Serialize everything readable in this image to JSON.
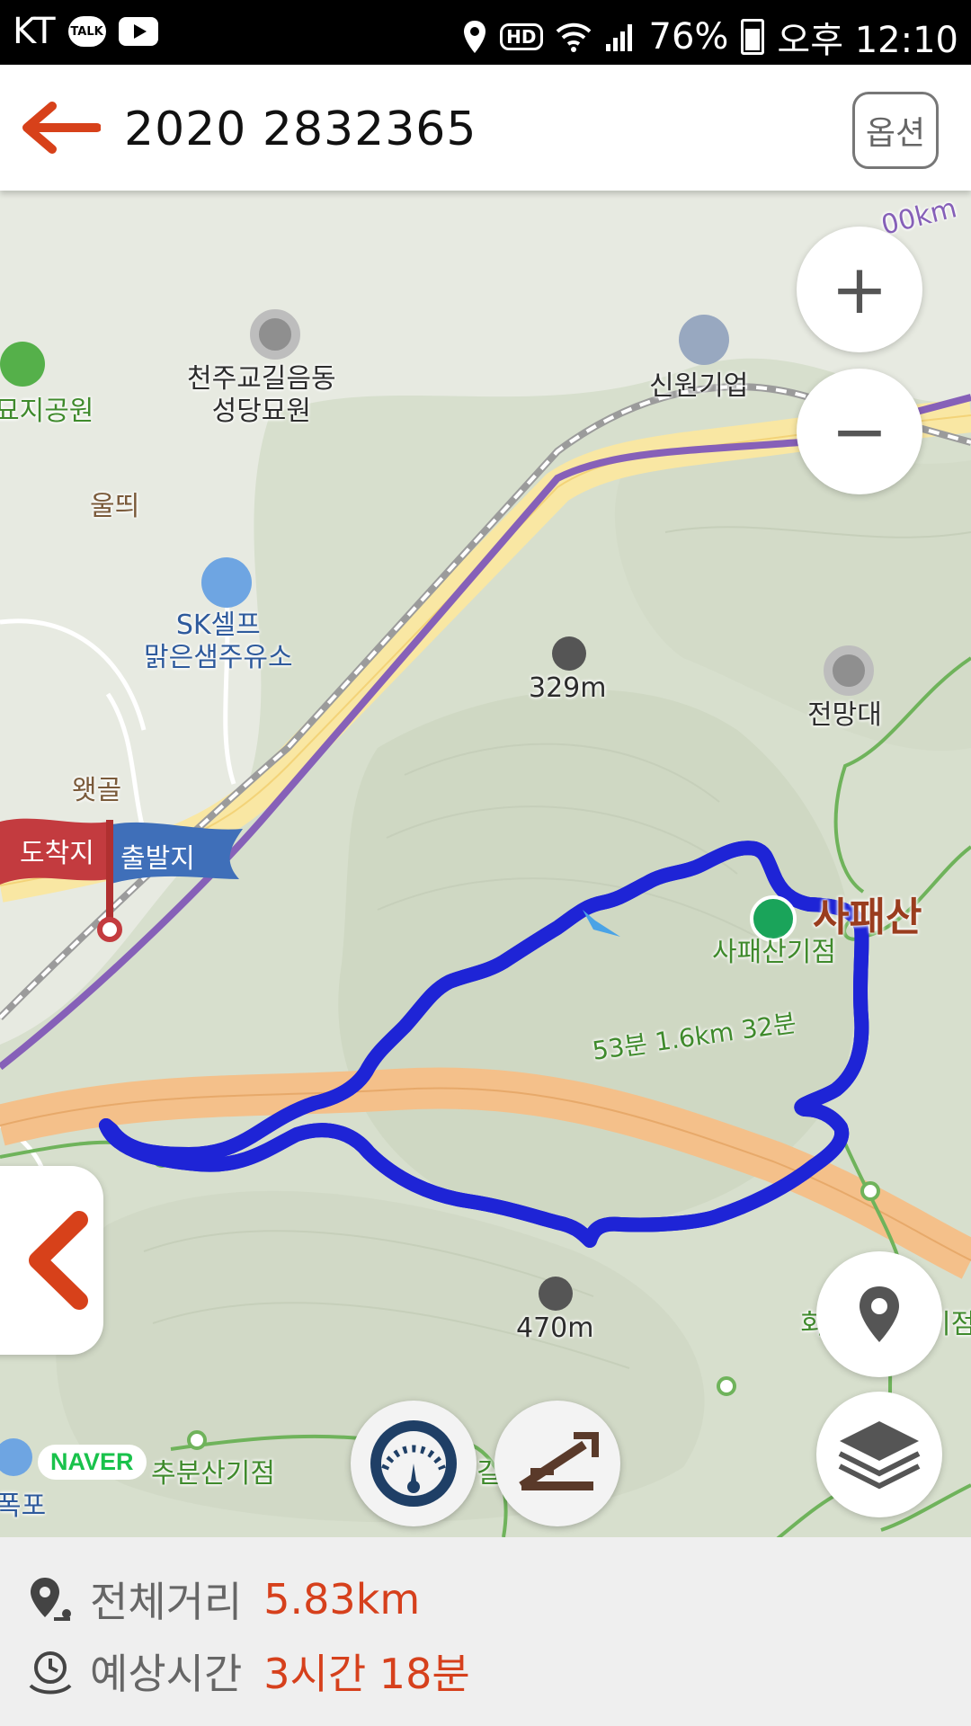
{
  "status_bar": {
    "carrier": "KT",
    "talk_icon_text": "TALK",
    "hd_label": "HD",
    "battery": "76%",
    "time": "오후 12:10"
  },
  "header": {
    "title": "2020 2832365",
    "option_label": "옵션"
  },
  "map": {
    "labels": {
      "cemetery_left": "묘지공원",
      "catholic_cemetery": "천주교길음동\n성당묘원",
      "village_ulttui": "울띄",
      "gas_station": "SK셀프\n맑은샘주유소",
      "company": "신원기업",
      "peak_329": "329m",
      "observatory": "전망대",
      "village_waetgol": "왯골",
      "mountain": "사패산",
      "mountain_point": "사패산기점",
      "route_time": "53분 1.6km 32분",
      "peak_470": "470m",
      "left_bottom": "폭포",
      "bottom_point": "추분산기점",
      "right_edge": "회",
      "right_edge2": "기점",
      "highway_label": "00km",
      "bottom_mid": "길"
    },
    "flags": {
      "arrival": "도착지",
      "departure": "출발지"
    },
    "naver_logo": "NAVER",
    "route_color": "#1e24d6"
  },
  "controls": {
    "zoom_in": "+",
    "zoom_out": "−"
  },
  "summary": {
    "distance_label": "전체거리",
    "distance_value": "5.83km",
    "time_label": "예상시간",
    "time_value": "3시간 18분"
  }
}
